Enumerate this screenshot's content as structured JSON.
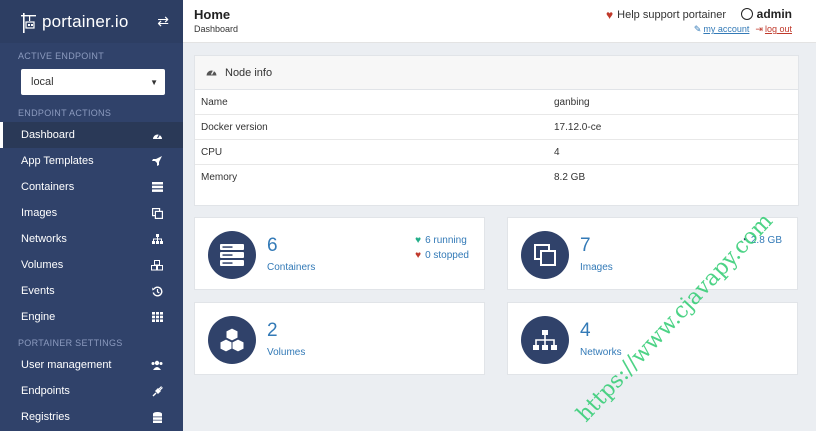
{
  "brand": {
    "name": "portainer.io"
  },
  "sidebar": {
    "active_endpoint_heading": "ACTIVE ENDPOINT",
    "endpoint_value": "local",
    "endpoint_actions_heading": "ENDPOINT ACTIONS",
    "items": [
      {
        "label": "Dashboard",
        "icon": "dashboard-icon"
      },
      {
        "label": "App Templates",
        "icon": "rocket-icon"
      },
      {
        "label": "Containers",
        "icon": "server-icon"
      },
      {
        "label": "Images",
        "icon": "clone-icon"
      },
      {
        "label": "Networks",
        "icon": "sitemap-icon"
      },
      {
        "label": "Volumes",
        "icon": "cubes-icon"
      },
      {
        "label": "Events",
        "icon": "history-icon"
      },
      {
        "label": "Engine",
        "icon": "th-icon"
      }
    ],
    "portainer_settings_heading": "PORTAINER SETTINGS",
    "settings_items": [
      {
        "label": "User management",
        "icon": "users-icon"
      },
      {
        "label": "Endpoints",
        "icon": "plug-icon"
      },
      {
        "label": "Registries",
        "icon": "database-icon"
      }
    ]
  },
  "header": {
    "title": "Home",
    "breadcrumb": "Dashboard",
    "support": "Help support portainer",
    "username": "admin",
    "my_account": "my account",
    "log_out": "log out"
  },
  "node_info": {
    "title": "Node info",
    "rows": [
      {
        "key": "Name",
        "value": "ganbing"
      },
      {
        "key": "Docker version",
        "value": "17.12.0-ce"
      },
      {
        "key": "CPU",
        "value": "4"
      },
      {
        "key": "Memory",
        "value": "8.2 GB"
      }
    ]
  },
  "widgets": {
    "containers": {
      "count": "6",
      "label": "Containers",
      "running": "6 running",
      "stopped": "0 stopped"
    },
    "images": {
      "count": "7",
      "label": "Images",
      "size": "2.8 GB"
    },
    "volumes": {
      "count": "2",
      "label": "Volumes"
    },
    "networks": {
      "count": "4",
      "label": "Networks"
    }
  },
  "watermark": "https://www.cjavapy.com",
  "colors": {
    "sidebar": "#30426a",
    "accent": "#337ab7",
    "running": "#23ae89",
    "stopped": "#c0392b"
  }
}
